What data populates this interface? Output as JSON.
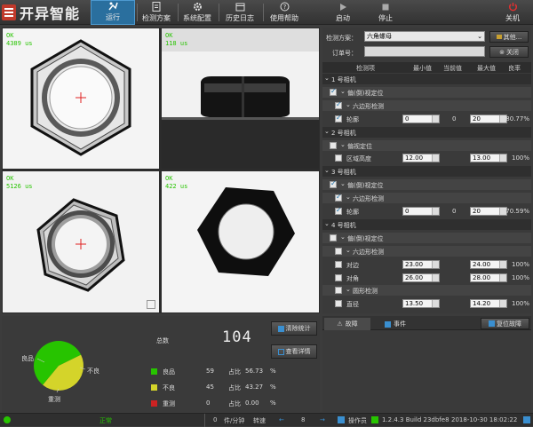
{
  "brand": {
    "name": "开异智能"
  },
  "toolbar": [
    {
      "label": "运行",
      "icon": "run-icon",
      "active": true
    },
    {
      "label": "检测方案",
      "icon": "document-icon"
    },
    {
      "label": "系统配置",
      "icon": "gear-icon"
    },
    {
      "label": "历史日志",
      "icon": "calendar-icon"
    },
    {
      "label": "使用帮助",
      "icon": "help-icon"
    },
    {
      "label": "启动",
      "icon": "play-icon"
    },
    {
      "label": "停止",
      "icon": "stop-icon"
    },
    {
      "label": "关机",
      "icon": "power-icon"
    }
  ],
  "cameras": [
    {
      "status": "OK",
      "time": "4389 us"
    },
    {
      "status": "OK",
      "time": "118 us"
    },
    {
      "status": "OK",
      "time": "5126 us"
    },
    {
      "status": "OK",
      "time": "422 us"
    }
  ],
  "scheme": {
    "label": "检测方案：",
    "value": "六角螺母",
    "other_btn": "其他...",
    "order_label": "订单号：",
    "order_value": "",
    "close_btn": "关闭"
  },
  "table": {
    "headers": [
      "检测项",
      "最小值",
      "当前值",
      "最大值",
      "良率"
    ],
    "rows": [
      {
        "kind": "group",
        "text": "1 号相机"
      },
      {
        "kind": "sub",
        "text": "偏(倒)视定位",
        "checked": true
      },
      {
        "kind": "sub2",
        "text": "六边形检测",
        "checked": true
      },
      {
        "kind": "item",
        "text": "轮廓",
        "checked": true,
        "min": "0",
        "cur": "0",
        "max": "20",
        "rate": "80.77%"
      },
      {
        "kind": "group",
        "text": "2 号相机"
      },
      {
        "kind": "sub",
        "text": "偏视定位",
        "checked": false
      },
      {
        "kind": "item",
        "text": "区域高度",
        "checked": false,
        "min": "12.00",
        "cur": "",
        "max": "13.00",
        "rate": "100%"
      },
      {
        "kind": "group",
        "text": "3 号相机"
      },
      {
        "kind": "sub",
        "text": "偏(倒)视定位",
        "checked": true
      },
      {
        "kind": "sub2",
        "text": "六边形检测",
        "checked": true
      },
      {
        "kind": "item",
        "text": "轮廓",
        "checked": true,
        "min": "0",
        "cur": "0",
        "max": "20",
        "rate": "70.59%"
      },
      {
        "kind": "group",
        "text": "4 号相机"
      },
      {
        "kind": "sub",
        "text": "偏(倒)视定位",
        "checked": false
      },
      {
        "kind": "sub2",
        "text": "六边形检测",
        "checked": false
      },
      {
        "kind": "item",
        "text": "对边",
        "checked": false,
        "min": "23.00",
        "cur": "",
        "max": "24.00",
        "rate": "100%"
      },
      {
        "kind": "item",
        "text": "对角",
        "checked": false,
        "min": "26.00",
        "cur": "",
        "max": "28.00",
        "rate": "100%"
      },
      {
        "kind": "sub2",
        "text": "圆形检测",
        "checked": false
      },
      {
        "kind": "item",
        "text": "直径",
        "checked": false,
        "min": "13.50",
        "cur": "",
        "max": "14.20",
        "rate": "100%"
      }
    ]
  },
  "stats": {
    "total_label": "总数",
    "total": "104",
    "clear_btn": "清除统计",
    "detail_btn": "查看详情",
    "pie_labels": {
      "good": "良品",
      "bad": "不良",
      "retest": "重测"
    },
    "items": [
      {
        "label": "良品",
        "count": "59",
        "ratio_label": "占比",
        "ratio": "56.73",
        "unit": "%",
        "color": "#27c400"
      },
      {
        "label": "不良",
        "count": "45",
        "ratio_label": "占比",
        "ratio": "43.27",
        "unit": "%",
        "color": "#d4d42a"
      },
      {
        "label": "重测",
        "count": "0",
        "ratio_label": "占比",
        "ratio": "0.00",
        "unit": "%",
        "color": "#cc2222"
      }
    ],
    "fractions": [
      0.5673,
      0.4327,
      0.0
    ]
  },
  "faults": {
    "tab1": "故障",
    "tab2": "事件",
    "reset_btn": "复位故障"
  },
  "statusbar": {
    "state": "正常",
    "speed": "0",
    "speed_unit": "件/分钟",
    "rpm_label": "转速",
    "rpm": "8",
    "user": "操作员",
    "version": "1.2.4.3 Build 23dbfe8",
    "datetime": "2018-10-30 18:02:22"
  }
}
